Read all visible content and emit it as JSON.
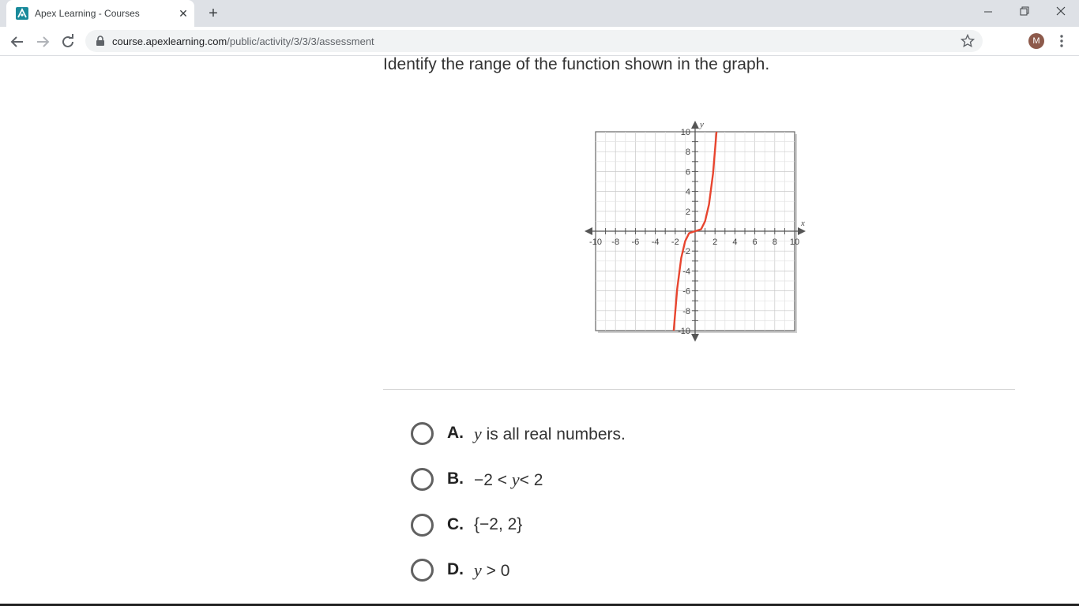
{
  "browser": {
    "tab_title": "Apex Learning - Courses",
    "tab_close": "✕",
    "new_tab": "+",
    "url_domain": "course.apexlearning.com",
    "url_path": "/public/activity/3/3/3/assessment",
    "profile_initial": "M"
  },
  "question": {
    "prompt": "Identify the range of the function shown in the graph."
  },
  "graph": {
    "x_axis_label": "x",
    "y_axis_label": "y",
    "x_ticks": [
      "-10",
      "-8",
      "-6",
      "-4",
      "-2",
      "2",
      "4",
      "6",
      "8",
      "10"
    ],
    "y_ticks": [
      "10",
      "8",
      "6",
      "4",
      "2",
      "-2",
      "-4",
      "-6",
      "-8",
      "-10"
    ],
    "curve_color": "#e8452f"
  },
  "chart_data": {
    "type": "line",
    "xlim": [
      -10,
      10
    ],
    "ylim": [
      -10,
      10
    ],
    "grid": true,
    "series": [
      {
        "x": [
          -2.15,
          -1.8,
          -1.4,
          -1.0,
          -0.6,
          0,
          0.6,
          1.0,
          1.4,
          1.8,
          2.15
        ],
        "y": [
          -10,
          -5.8,
          -2.7,
          -1.0,
          -0.2,
          0,
          0.2,
          1.0,
          2.7,
          5.8,
          10
        ]
      }
    ]
  },
  "choices": [
    {
      "letter": "A.",
      "var": "y",
      "text": "is all real numbers."
    },
    {
      "letter": "B.",
      "pre": "−2 < ",
      "var": "y",
      "text": "< 2"
    },
    {
      "letter": "C.",
      "pre": "{−2, 2}",
      "var": "",
      "text": ""
    },
    {
      "letter": "D.",
      "pre": "",
      "var": "y",
      "text": " > 0"
    }
  ]
}
